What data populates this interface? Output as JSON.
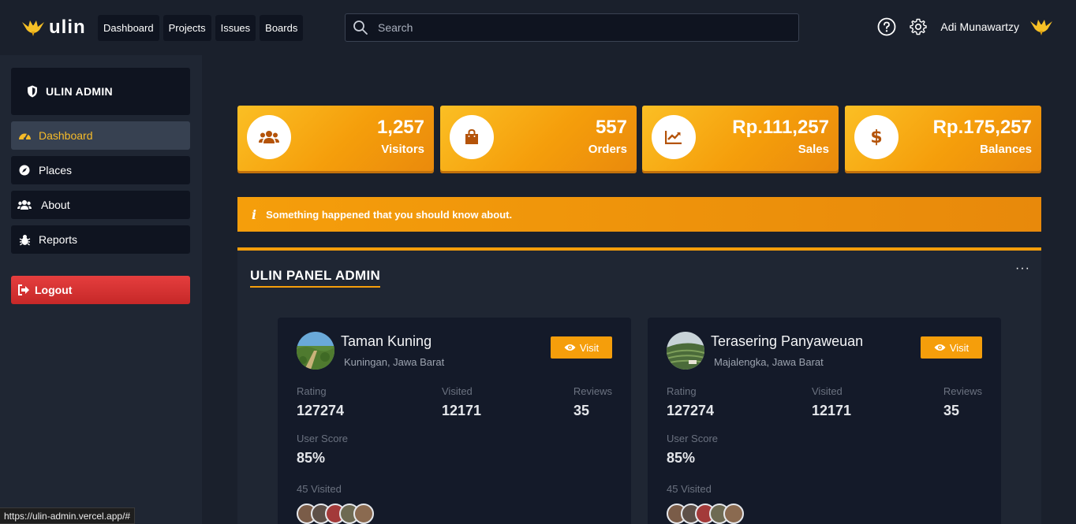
{
  "app": {
    "logo_text": "ulin"
  },
  "topnav": [
    "Dashboard",
    "Projects",
    "Issues",
    "Boards"
  ],
  "search": {
    "placeholder": "Search",
    "value": ""
  },
  "user": {
    "name": "Adi Munawartzy"
  },
  "sidebar": {
    "title": "ULIN ADMIN",
    "items": [
      {
        "label": "Dashboard",
        "icon": "gauge-icon",
        "active": true
      },
      {
        "label": "Places",
        "icon": "compass-icon",
        "active": false
      },
      {
        "label": "About",
        "icon": "users-icon",
        "active": false
      },
      {
        "label": "Reports",
        "icon": "bug-icon",
        "active": false
      }
    ],
    "logout": "Logout"
  },
  "stats": [
    {
      "value": "1,257",
      "label": "Visitors",
      "icon": "users-icon"
    },
    {
      "value": "557",
      "label": "Orders",
      "icon": "shopping-bag-icon"
    },
    {
      "value": "Rp.111,257",
      "label": "Sales",
      "icon": "chart-line-icon"
    },
    {
      "value": "Rp.175,257",
      "label": "Balances",
      "icon": "dollar-icon"
    }
  ],
  "alert": {
    "icon": "info-icon",
    "text": "Something happened that you should know about."
  },
  "panel": {
    "title": "ULIN PANEL ADMIN",
    "menu": "···"
  },
  "places": [
    {
      "name": "Taman Kuning",
      "location": "Kuningan, Jawa Barat",
      "visit_label": "Visit",
      "rating_label": "Rating",
      "rating": "127274",
      "visited_label": "Visited",
      "visited": "12171",
      "reviews_label": "Reviews",
      "reviews": "35",
      "score_label": "User Score",
      "score": "85%",
      "visited_count": "45 Visited"
    },
    {
      "name": "Terasering Panyaweuan",
      "location": "Majalengka, Jawa Barat",
      "visit_label": "Visit",
      "rating_label": "Rating",
      "rating": "127274",
      "visited_label": "Visited",
      "visited": "12171",
      "reviews_label": "Reviews",
      "reviews": "35",
      "score_label": "User Score",
      "score": "85%",
      "visited_count": "45 Visited"
    }
  ],
  "status_bar": {
    "url": "https://ulin-admin.vercel.app/#"
  },
  "colors": {
    "accent": "#f59e0b",
    "danger": "#e53e3e",
    "bg": "#1a202c",
    "card": "#141a29"
  }
}
